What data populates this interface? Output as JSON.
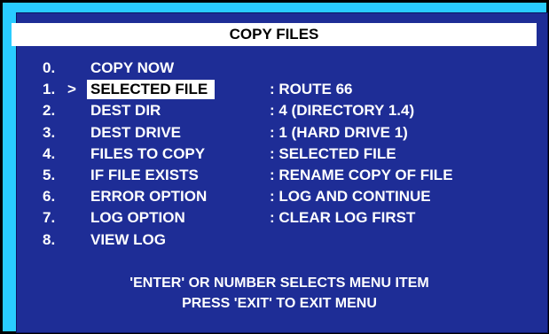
{
  "colors": {
    "outer_background": "#29ccff",
    "screen_background": "#1e2d96",
    "text": "#ffffff",
    "title_bar_background": "#ffffff",
    "selected_background": "#ffffff"
  },
  "title": "COPY FILES",
  "cursor": ">",
  "menu": {
    "items": [
      {
        "number": "0.",
        "label": "COPY NOW",
        "value": ""
      },
      {
        "number": "1.",
        "label": "SELECTED FILE",
        "value": ": ROUTE 66"
      },
      {
        "number": "2.",
        "label": "DEST DIR",
        "value": ": 4 (DIRECTORY 1.4)"
      },
      {
        "number": "3.",
        "label": "DEST DRIVE",
        "value": ": 1 (HARD DRIVE 1)"
      },
      {
        "number": "4.",
        "label": "FILES TO COPY",
        "value": ": SELECTED FILE"
      },
      {
        "number": "5.",
        "label": "IF FILE EXISTS",
        "value": ": RENAME COPY OF FILE"
      },
      {
        "number": "6.",
        "label": "ERROR OPTION",
        "value": ": LOG AND CONTINUE"
      },
      {
        "number": "7.",
        "label": "LOG OPTION",
        "value": ": CLEAR LOG FIRST"
      },
      {
        "number": "8.",
        "label": "VIEW LOG",
        "value": ""
      }
    ]
  },
  "footer": {
    "line1": "'ENTER' OR NUMBER SELECTS MENU ITEM",
    "line2": "PRESS 'EXIT' TO EXIT MENU"
  }
}
